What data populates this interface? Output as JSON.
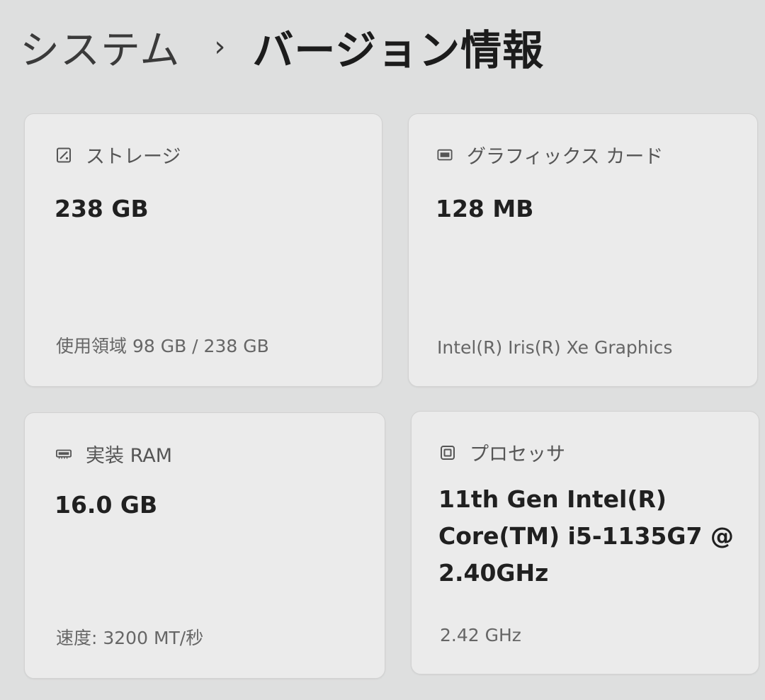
{
  "breadcrumb": {
    "parent": "システム",
    "separator": "›",
    "current": "バージョン情報"
  },
  "cards": {
    "storage": {
      "icon": "storage-icon",
      "label": "ストレージ",
      "value": "238 GB",
      "detail": "使用領域 98 GB / 238 GB"
    },
    "graphics": {
      "icon": "graphics-card-icon",
      "label": "グラフィックス カード",
      "value": "128 MB",
      "detail": "Intel(R) Iris(R) Xe Graphics"
    },
    "ram": {
      "icon": "memory-icon",
      "label": "実装 RAM",
      "value": "16.0 GB",
      "detail": "速度: 3200 MT/秒"
    },
    "processor": {
      "icon": "processor-icon",
      "label": "プロセッサ",
      "value": "11th Gen Intel(R) Core(TM) i5-1135G7 @ 2.40GHz",
      "detail": "2.42 GHz"
    }
  }
}
